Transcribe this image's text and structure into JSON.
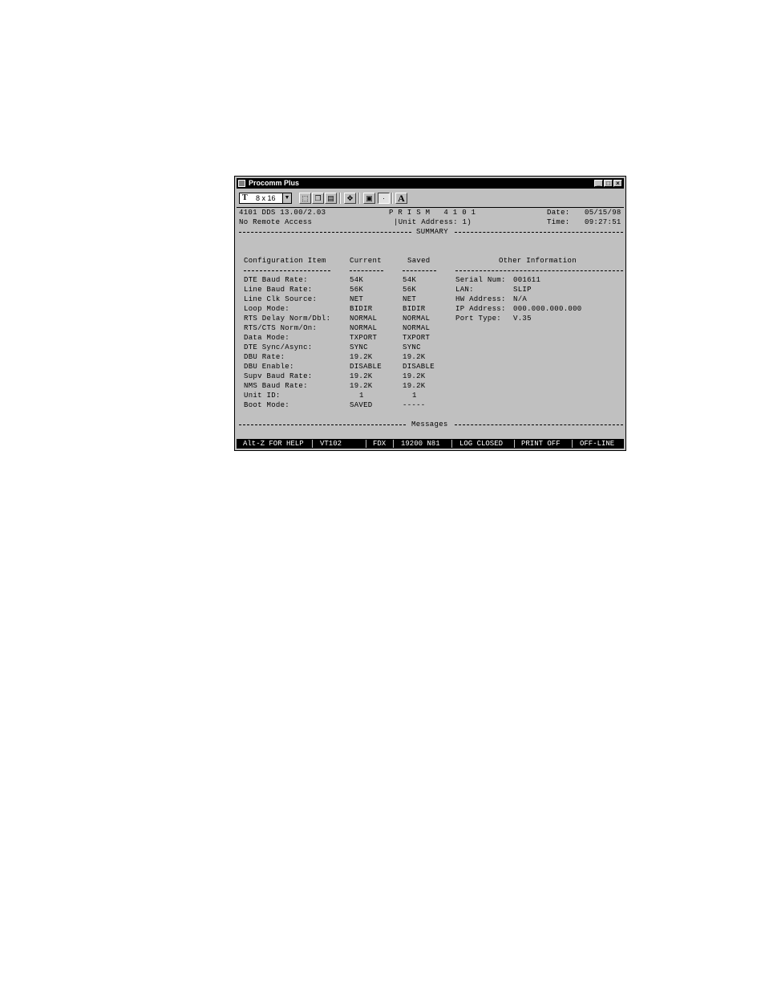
{
  "window": {
    "title": "Procomm Plus"
  },
  "toolbar": {
    "font_size": "8 x 16",
    "font_prefix": "T",
    "font_button_label": "A",
    "icons": [
      "tt-font-icon",
      "dropdown-arrow-icon",
      "select-all-icon",
      "copy-icon",
      "paste-icon",
      "move-icon",
      "clipboard-icon",
      "cursor-icon",
      "font-icon"
    ]
  },
  "header": {
    "version": "4101 DDS 13.00/2.03",
    "remote_access": "No Remote Access",
    "product": "P R I S M   4 1 0 1",
    "unit_address": "|Unit Address: 1)",
    "date_label": "Date:",
    "date_value": "05/15/98",
    "time_label": "Time:",
    "time_value": "09:27:51"
  },
  "summary_title": "SUMMARY",
  "messages_title": "Messages",
  "table": {
    "headers": {
      "item": "Configuration Item",
      "current": "Current",
      "saved": "Saved",
      "other": "Other Information"
    },
    "rows": [
      {
        "item": "DTE Baud Rate:",
        "current": "54K",
        "saved": "54K"
      },
      {
        "item": "Line Baud Rate:",
        "current": "56K",
        "saved": "56K"
      },
      {
        "item": "Line Clk Source:",
        "current": "NET",
        "saved": "NET"
      },
      {
        "item": "Loop Mode:",
        "current": "BIDIR",
        "saved": "BIDIR"
      },
      {
        "item": "RTS Delay Norm/Dbl:",
        "current": "NORMAL",
        "saved": "NORMAL"
      },
      {
        "item": "RTS/CTS Norm/On:",
        "current": "NORMAL",
        "saved": "NORMAL"
      },
      {
        "item": "Data Mode:",
        "current": "TXPORT",
        "saved": "TXPORT"
      },
      {
        "item": "DTE Sync/Async:",
        "current": "SYNC",
        "saved": "SYNC"
      },
      {
        "item": "DBU Rate:",
        "current": "19.2K",
        "saved": "19.2K"
      },
      {
        "item": "DBU Enable:",
        "current": "DISABLE",
        "saved": "DISABLE"
      },
      {
        "item": "Supv Baud Rate:",
        "current": "19.2K",
        "saved": "19.2K"
      },
      {
        "item": "NMS Baud Rate:",
        "current": "19.2K",
        "saved": "19.2K"
      },
      {
        "item": "Unit ID:",
        "current": "1",
        "saved": "1"
      },
      {
        "item": "Boot Mode:",
        "current": "SAVED",
        "saved": "-----"
      }
    ],
    "other": [
      {
        "label": "Serial Num:",
        "value": "001611"
      },
      {
        "label": "LAN:",
        "value": "SLIP"
      },
      {
        "label": "HW Address:",
        "value": "N/A"
      },
      {
        "label": "IP Address:",
        "value": "000.000.000.000"
      },
      {
        "label": "Port Type:",
        "value": "V.35"
      }
    ]
  },
  "statusbar": {
    "help": "Alt-Z FOR HELP",
    "terminal": "VT102",
    "duplex": "FDX",
    "settings": "19200 N81",
    "log": "LOG CLOSED",
    "print": "PRINT OFF",
    "line": "OFF-LINE"
  }
}
